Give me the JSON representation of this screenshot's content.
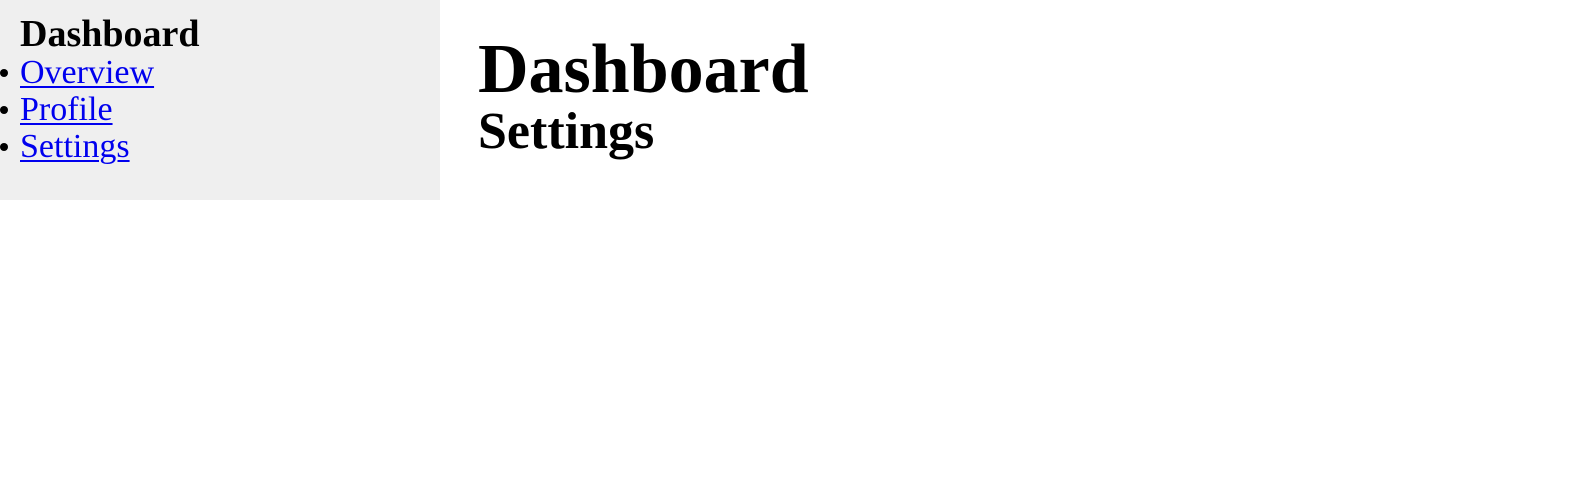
{
  "sidebar": {
    "title": "Dashboard",
    "background": "#efefef",
    "items": [
      {
        "label": "Overview"
      },
      {
        "label": "Profile"
      },
      {
        "label": "Settings"
      }
    ]
  },
  "main": {
    "title": "Dashboard",
    "section_title": "Settings"
  },
  "colors": {
    "link": "#0000ee",
    "text": "#000000",
    "page_background": "#ffffff"
  }
}
